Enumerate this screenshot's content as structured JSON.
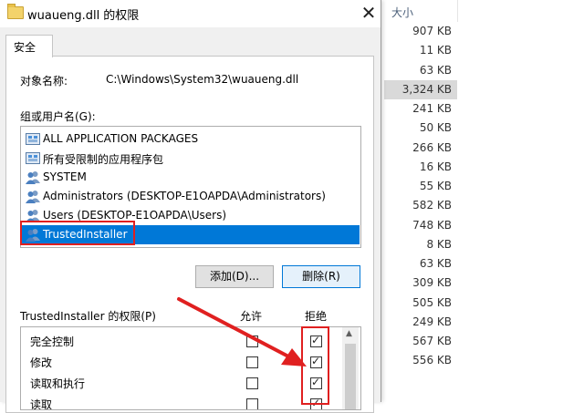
{
  "background_list": {
    "header": "大小",
    "sizes": [
      "907 KB",
      "11 KB",
      "63 KB",
      "3,324 KB",
      "241 KB",
      "50 KB",
      "266 KB",
      "16 KB",
      "55 KB",
      "582 KB",
      "748 KB",
      "8 KB",
      "63 KB",
      "309 KB",
      "505 KB",
      "249 KB",
      "567 KB",
      "556 KB"
    ],
    "selected_index": 3
  },
  "dialog": {
    "title": "wuaueng.dll 的权限",
    "close_glyph": "✕",
    "tab": "安全",
    "object_label": "对象名称:",
    "object_value": "C:\\Windows\\System32\\wuaueng.dll",
    "group_label": "组或用户名(G):",
    "users": [
      {
        "name": "ALL APPLICATION PACKAGES",
        "icon": "app-package-icon"
      },
      {
        "name": "所有受限制的应用程序包",
        "icon": "app-package-icon"
      },
      {
        "name": "SYSTEM",
        "icon": "user-group-icon"
      },
      {
        "name": "Administrators (DESKTOP-E1OAPDA\\Administrators)",
        "icon": "user-group-icon"
      },
      {
        "name": "Users (DESKTOP-E1OAPDA\\Users)",
        "icon": "user-group-icon"
      },
      {
        "name": "TrustedInstaller",
        "icon": "user-group-icon"
      }
    ],
    "selected_user_index": 5,
    "add_button": "添加(D)...",
    "remove_button": "删除(R)",
    "perm_label": "TrustedInstaller 的权限(P)",
    "allow_header": "允许",
    "deny_header": "拒绝",
    "permissions": [
      {
        "name": "完全控制",
        "allow": false,
        "deny": true
      },
      {
        "name": "修改",
        "allow": false,
        "deny": true
      },
      {
        "name": "读取和执行",
        "allow": false,
        "deny": true
      },
      {
        "name": "读取",
        "allow": false,
        "deny": true
      }
    ],
    "accent_color": "#0078d7",
    "annotation_color": "#e02020"
  }
}
